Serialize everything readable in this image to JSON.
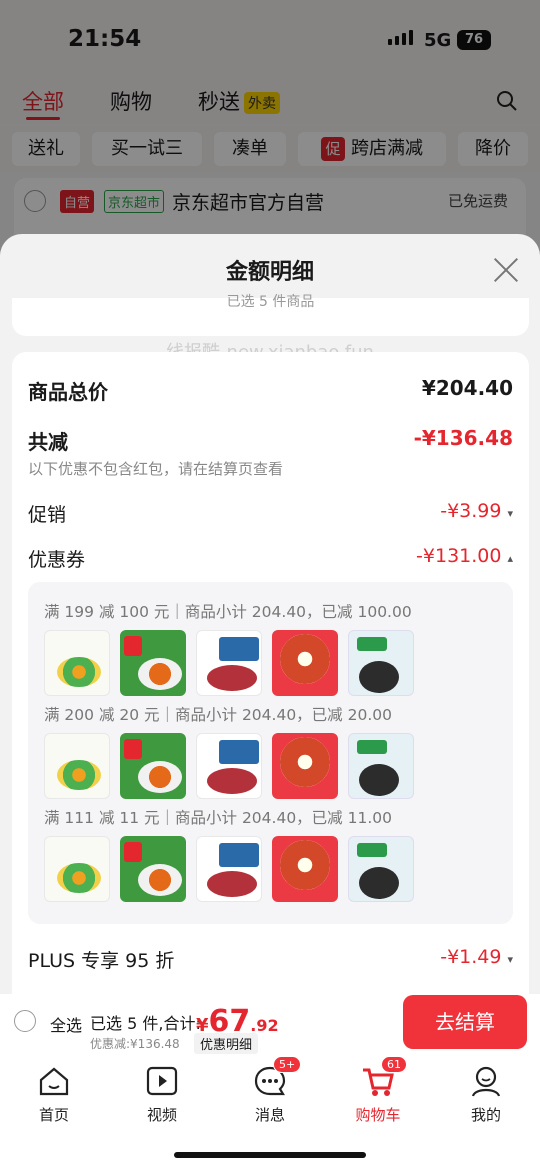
{
  "status_bar": {
    "time": "21:54",
    "network": "5G",
    "battery": "76"
  },
  "top_tabs": [
    {
      "label": "全部"
    },
    {
      "label": "购物"
    },
    {
      "label": "秒送"
    }
  ],
  "waimai_badge": "外卖",
  "filter_chips": [
    "送礼",
    "买一试三",
    "凑单",
    "跨店满减",
    "降价"
  ],
  "promo_icon_text": "促",
  "shop_row": {
    "tag_self": "自营",
    "tag_store": "京东超市",
    "name": "京东超市官方自营",
    "shipping": "已免运费"
  },
  "sheet": {
    "title": "金额明细",
    "selected_text": "已选 5 件商品",
    "watermark": "线报酷-new.xianbao.fun",
    "total_label": "商品总价",
    "total_value": "¥204.40",
    "discount_label": "共减",
    "discount_value": "-¥136.48",
    "discount_note": "以下优惠不包含红包，请在结算页查看",
    "promo_label": "促销",
    "promo_value": "-¥3.99",
    "coupon_label": "优惠券",
    "coupon_value": "-¥131.00",
    "coupon_groups": [
      {
        "text": "满 199 减 100 元｜商品小计 204.40，已减 100.00"
      },
      {
        "text": "满 200 减 20 元｜商品小计 204.40，已减 20.00"
      },
      {
        "text": "满 111 减 11 元｜商品小计 204.40，已减 11.00"
      }
    ],
    "plus_label": "PLUS 专享 95 折",
    "plus_value": "-¥1.49"
  },
  "bottom_bar": {
    "select_all": "全选",
    "selected_summary": "已选 5 件,合计:",
    "currency": "¥",
    "price_int": "67",
    "price_dec": ".92",
    "saved": "优惠减:¥136.48",
    "detail_btn": "优惠明细",
    "checkout": "去结算"
  },
  "nav": [
    {
      "label": "首页",
      "icon": "home-icon"
    },
    {
      "label": "视频",
      "icon": "video-icon"
    },
    {
      "label": "消息",
      "icon": "message-icon",
      "badge": "5+"
    },
    {
      "label": "购物车",
      "icon": "cart-icon",
      "badge": "61"
    },
    {
      "label": "我的",
      "icon": "profile-icon"
    }
  ],
  "colors": {
    "accent": "#e4262f",
    "checkout": "#f0323a"
  }
}
